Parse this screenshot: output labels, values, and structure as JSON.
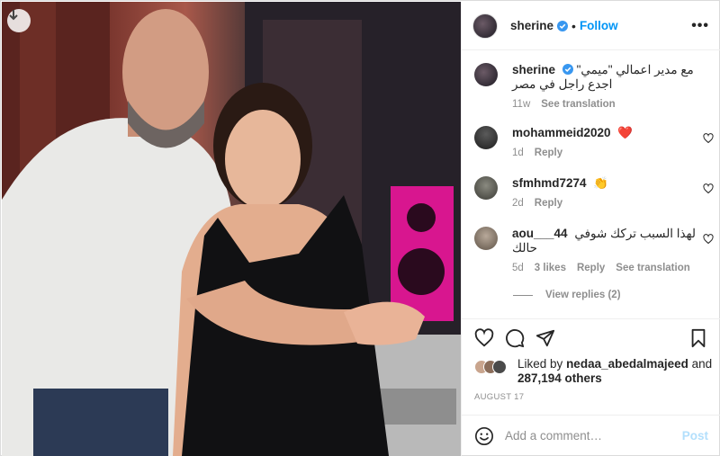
{
  "post": {
    "username": "sherine",
    "follow_label": "Follow",
    "more_icon": "more-options-icon"
  },
  "caption": {
    "username": "sherine",
    "text": "مع مدير اعمالي \"ميمي\" اجدع راجل في مصر",
    "time": "11w",
    "see_translation": "See translation"
  },
  "comments": [
    {
      "username": "mohammeid2020",
      "text": "❤️",
      "time": "1d",
      "reply": "Reply"
    },
    {
      "username": "sfmhmd7274",
      "text": "👏",
      "time": "2d",
      "reply": "Reply"
    },
    {
      "username": "aou___44",
      "text": "لهذا السبب تركك شوفي حالك",
      "time": "5d",
      "likes": "3 likes",
      "reply": "Reply",
      "see_translation": "See translation"
    }
  ],
  "view_replies": "View replies (2)",
  "likes": {
    "prefix": "Liked by",
    "user": "nedaa_abedalmajeed",
    "and": "and",
    "others": "287,194 others"
  },
  "date": "AUGUST 17",
  "add_comment": {
    "placeholder": "Add a comment…",
    "post_label": "Post"
  },
  "colors": {
    "accent": "#0095f6",
    "heart": "#ed4956",
    "post_disabled": "#b2dffc"
  }
}
